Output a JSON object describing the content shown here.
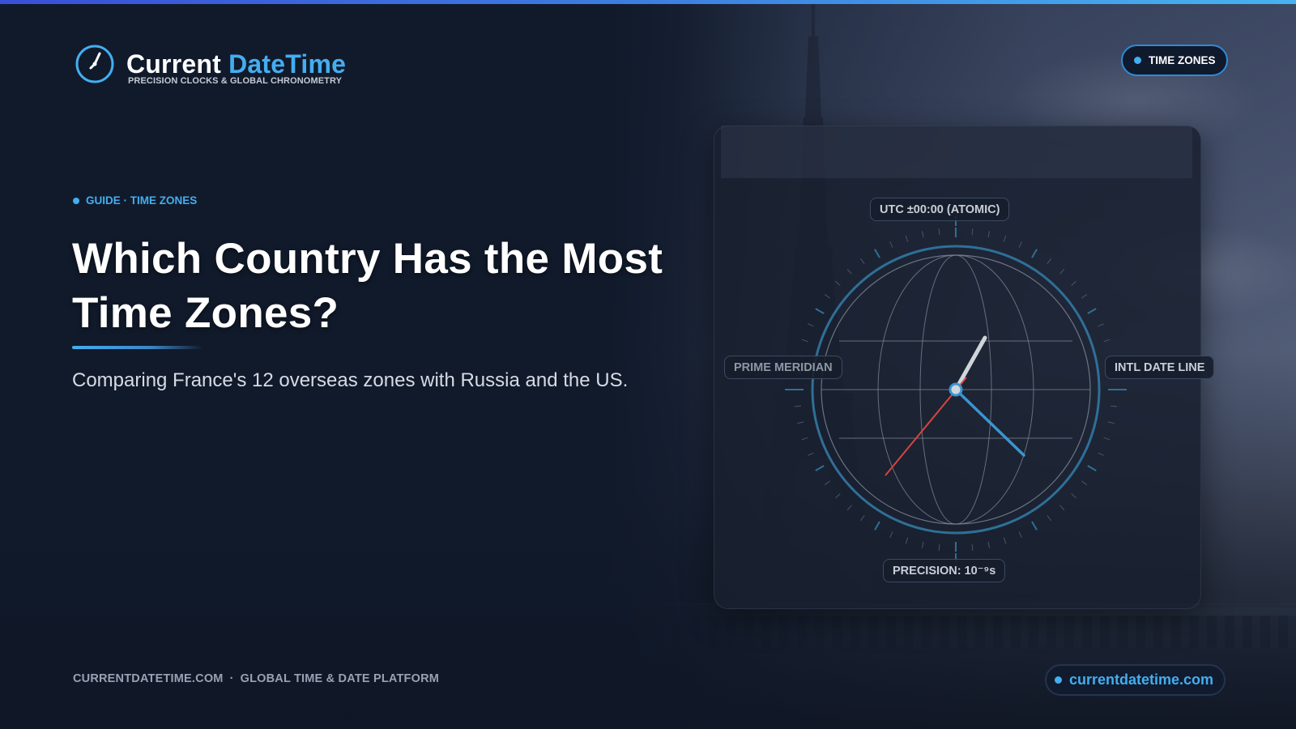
{
  "brand": {
    "name_part1": "Current",
    "name_part2": "DateTime",
    "tagline": "PRECISION CLOCKS & GLOBAL CHRONOMETRY"
  },
  "header": {
    "badge_label": "TIME ZONES"
  },
  "article": {
    "eyebrow": "GUIDE · TIME ZONES",
    "title": "Which Country Has the Most Time Zones?",
    "subtitle": "Comparing France's 12 overseas zones with Russia and the US."
  },
  "clock": {
    "top_label": "UTC ±00:00 (ATOMIC)",
    "left_label": "PRIME MERIDIAN",
    "right_label": "INTL DATE LINE",
    "bottom_label": "PRECISION: 10⁻⁹s"
  },
  "footer": {
    "domain": "CURRENTDATETIME.COM",
    "separator": "·",
    "platform": "GLOBAL TIME & DATE PLATFORM",
    "url": "currentdatetime.com"
  },
  "colors": {
    "accent": "#43aef0",
    "background": "#111a2b",
    "second_hand": "#d9443f",
    "ring": "#2f6f96"
  }
}
